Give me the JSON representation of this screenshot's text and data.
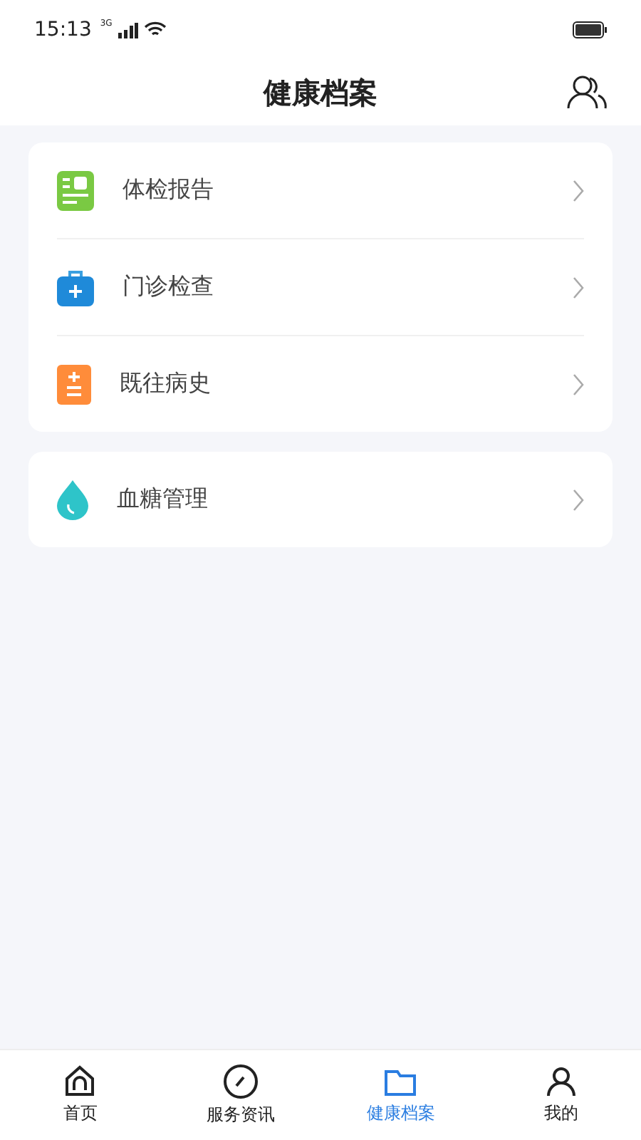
{
  "status_bar": {
    "time": "15:13",
    "network": "3G"
  },
  "header": {
    "title": "健康档案"
  },
  "groups": [
    {
      "items": [
        {
          "label": "体检报告",
          "kind": "report"
        },
        {
          "label": "门诊检查",
          "kind": "clinic"
        },
        {
          "label": "既往病史",
          "kind": "history"
        }
      ]
    },
    {
      "items": [
        {
          "label": "血糖管理",
          "kind": "glucose"
        }
      ]
    }
  ],
  "tab_bar": [
    {
      "label": "首页",
      "kind": "home",
      "selected": false
    },
    {
      "label": "服务资讯",
      "kind": "service",
      "selected": false
    },
    {
      "label": "健康档案",
      "kind": "records",
      "selected": true
    },
    {
      "label": "我的",
      "kind": "me",
      "selected": false
    }
  ]
}
